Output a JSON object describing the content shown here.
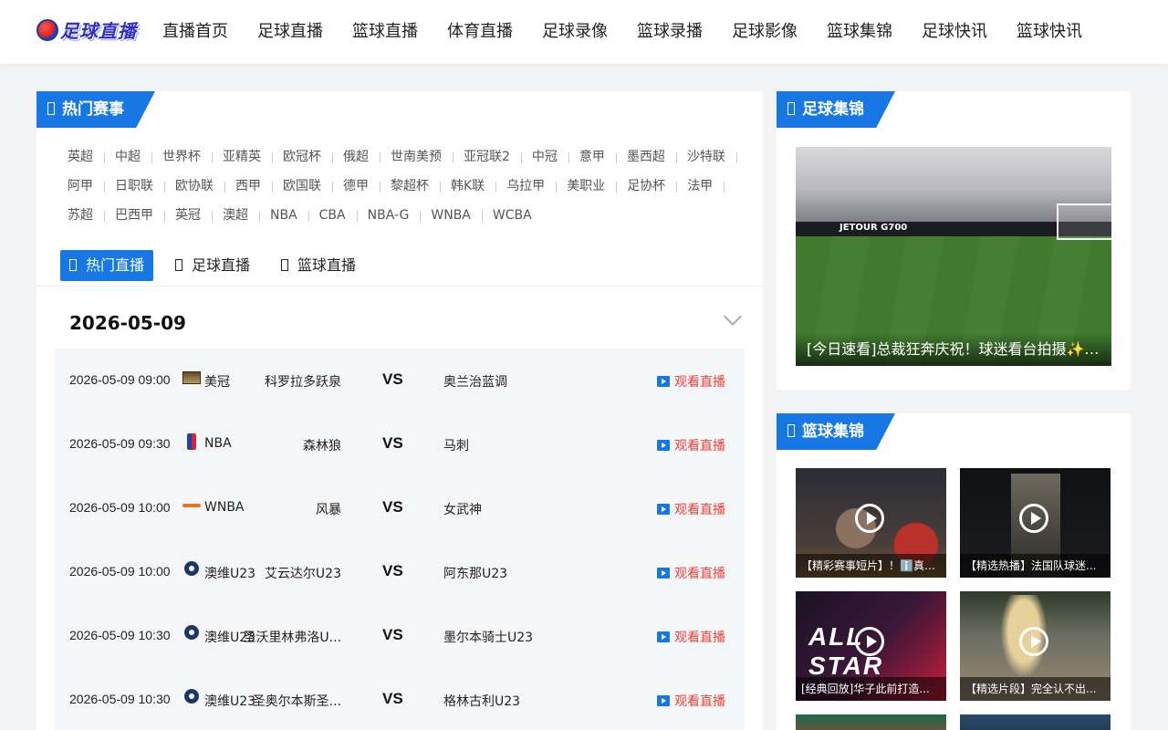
{
  "header": {
    "logo_text": "足球直播",
    "nav": [
      "直播首页",
      "足球直播",
      "篮球直播",
      "体育直播",
      "足球录像",
      "篮球录播",
      "足球影像",
      "篮球集锦",
      "足球快讯",
      "篮球快讯"
    ]
  },
  "hot_events": {
    "title": "热门赛事",
    "leagues": [
      "英超",
      "中超",
      "世界杯",
      "亚精英",
      "欧冠杯",
      "俄超",
      "世南美预",
      "亚冠联2",
      "中冠",
      "意甲",
      "墨西超",
      "沙特联",
      "阿甲",
      "日职联",
      "欧协联",
      "西甲",
      "欧国联",
      "德甲",
      "黎超杯",
      "韩K联",
      "乌拉甲",
      "美职业",
      "足协杯",
      "法甲",
      "苏超",
      "巴西甲",
      "英冠",
      "澳超",
      "NBA",
      "CBA",
      "NBA-G",
      "WNBA",
      "WCBA"
    ]
  },
  "tabs": [
    {
      "label": "热门直播",
      "active": true
    },
    {
      "label": "足球直播",
      "active": false
    },
    {
      "label": "篮球直播",
      "active": false
    }
  ],
  "date_heading": "2026-05-09",
  "matches": [
    {
      "time": "2026-05-09 09:00",
      "league": "美冠",
      "league_icon": "league-badge-icon",
      "home": "科罗拉多跃泉",
      "vs": "VS",
      "away": "奥兰治蓝调",
      "watch": "观看直播"
    },
    {
      "time": "2026-05-09 09:30",
      "league": "NBA",
      "league_icon": "nba-logo-icon",
      "home": "森林狼",
      "vs": "VS",
      "away": "马刺",
      "watch": "观看直播"
    },
    {
      "time": "2026-05-09 10:00",
      "league": "WNBA",
      "league_icon": "wnba-logo-icon",
      "home": "风暴",
      "vs": "VS",
      "away": "女武神",
      "watch": "观看直播"
    },
    {
      "time": "2026-05-09 10:00",
      "league": "澳维U23",
      "league_icon": "aus-badge-icon",
      "home": "艾云达尔U23",
      "vs": "VS",
      "away": "阿东那U23",
      "watch": "观看直播"
    },
    {
      "time": "2026-05-09 10:30",
      "league": "澳维U23",
      "league_icon": "aus-badge-icon",
      "home": "圣沃里林弗洛U...",
      "vs": "VS",
      "away": "墨尔本骑士U23",
      "watch": "观看直播"
    },
    {
      "time": "2026-05-09 10:30",
      "league": "澳维U23",
      "league_icon": "aus-badge-icon",
      "home": "圣奥尔本斯圣...",
      "vs": "VS",
      "away": "格林古利U23",
      "watch": "观看直播"
    }
  ],
  "football_highlights": {
    "title": "足球集锦",
    "caption": "[今日速看]总裁狂奔庆祝！球迷看台拍摄✨C...",
    "board_text": "JETOUR G700"
  },
  "basketball_highlights": {
    "title": "篮球集锦",
    "cards": [
      {
        "caption": "【精彩赛事短片】！ℹ️真！..."
      },
      {
        "caption": "【精选热播】法国队球迷..."
      },
      {
        "caption": "[经典回放]华子此前打造...",
        "overlay_text": "ALL STAR"
      },
      {
        "caption": "【精选片段】完全认不出..."
      }
    ]
  }
}
